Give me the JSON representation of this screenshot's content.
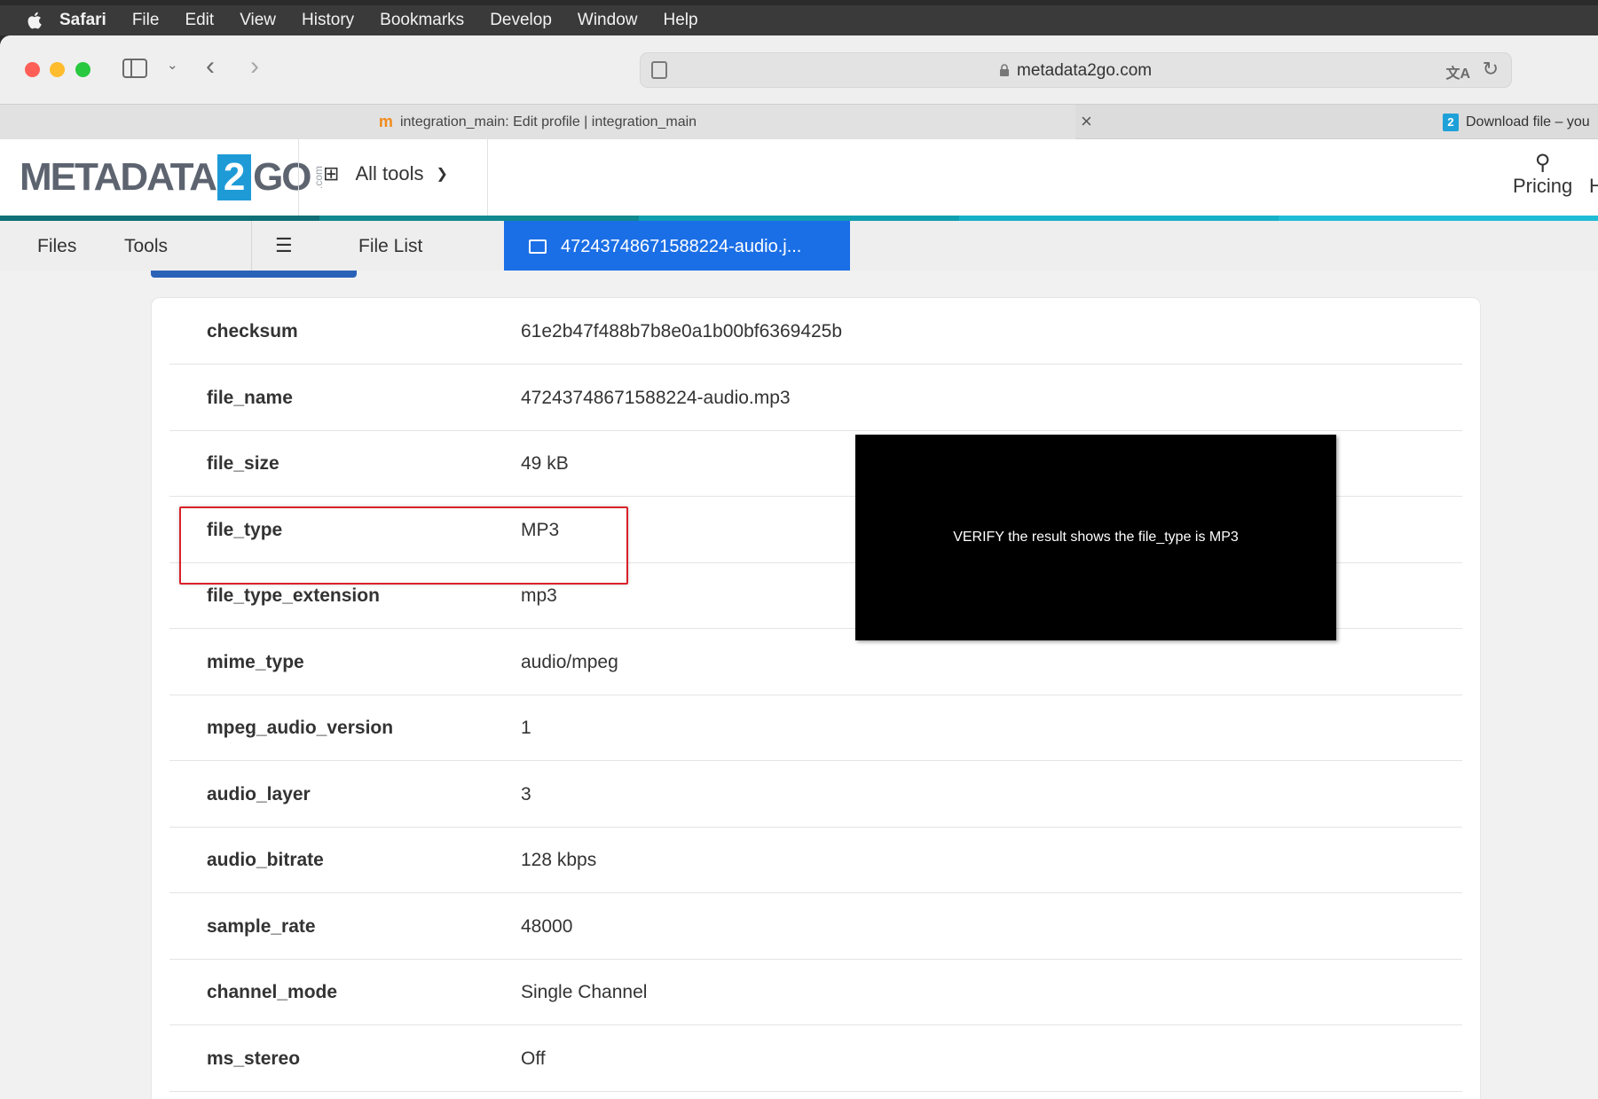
{
  "menubar": {
    "app": "Safari",
    "items": [
      "File",
      "Edit",
      "View",
      "History",
      "Bookmarks",
      "Develop",
      "Window",
      "Help"
    ]
  },
  "browser": {
    "url": "metadata2go.com",
    "tabs": [
      {
        "title": "integration_main: Edit profile | integration_main"
      },
      {
        "title": "Download file – you"
      }
    ]
  },
  "site": {
    "logo": {
      "left": "METADATA",
      "digit": "2",
      "right": "GO",
      "suffix": ".com"
    },
    "all_tools": "All tools",
    "pricing": "Pricing",
    "header_cut": "H",
    "accent_colors": [
      "#0f6e76",
      "#10898f",
      "#0f9fb0",
      "#17b0c8",
      "#20bcd6"
    ]
  },
  "filenav": {
    "files": "Files",
    "tools": "Tools",
    "file_list": "File List",
    "active_file": "47243748671588224-audio.j..."
  },
  "metadata": [
    {
      "key": "checksum",
      "value": "61e2b47f488b7b8e0a1b00bf6369425b"
    },
    {
      "key": "file_name",
      "value": "47243748671588224-audio.mp3"
    },
    {
      "key": "file_size",
      "value": "49 kB"
    },
    {
      "key": "file_type",
      "value": "MP3"
    },
    {
      "key": "file_type_extension",
      "value": "mp3"
    },
    {
      "key": "mime_type",
      "value": "audio/mpeg"
    },
    {
      "key": "mpeg_audio_version",
      "value": "1"
    },
    {
      "key": "audio_layer",
      "value": "3"
    },
    {
      "key": "audio_bitrate",
      "value": "128 kbps"
    },
    {
      "key": "sample_rate",
      "value": "48000"
    },
    {
      "key": "channel_mode",
      "value": "Single Channel"
    },
    {
      "key": "ms_stereo",
      "value": "Off"
    }
  ],
  "overlay": {
    "text": "VERIFY the result shows the file_type is MP3"
  }
}
